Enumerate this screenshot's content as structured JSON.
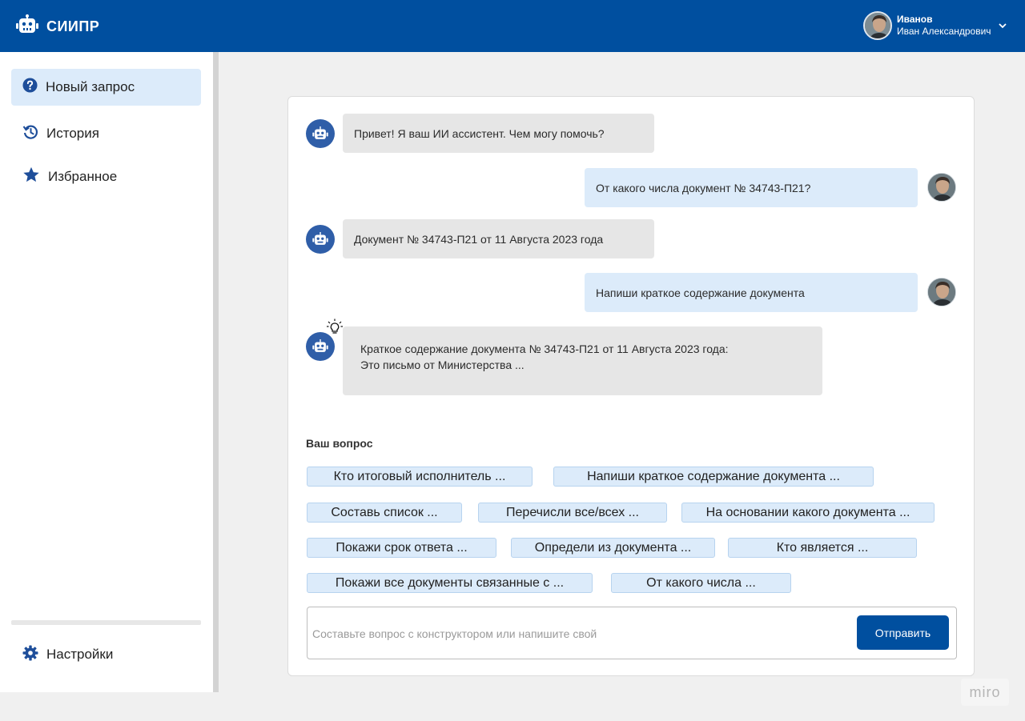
{
  "header": {
    "app_name": "СИИПР",
    "user_surname": "Иванов",
    "user_fullname": "Иван Александрович",
    "brand_color": "#004f9f"
  },
  "sidebar": {
    "items": [
      {
        "label": "Новый запрос",
        "icon": "question-circle-icon",
        "active": true
      },
      {
        "label": "История",
        "icon": "history-icon",
        "active": false
      },
      {
        "label": "Избранное",
        "icon": "star-icon",
        "active": false
      }
    ],
    "settings_label": "Настройки"
  },
  "chat": {
    "messages": [
      {
        "from": "bot",
        "text": "Привет! Я ваш ИИ ассистент. Чем могу помочь?"
      },
      {
        "from": "user",
        "text": "От какого числа документ № 34743-П21?"
      },
      {
        "from": "bot",
        "text": "Документ № 34743-П21 от 11 Августа 2023 года"
      },
      {
        "from": "user",
        "text": "Напиши краткое содержание документа"
      },
      {
        "from": "bot",
        "line1": "Краткое содержание документа № 34743-П21 от 11 Августа 2023 года:",
        "line2": "Это письмо от Министерства ..."
      }
    ]
  },
  "question": {
    "title": "Ваш вопрос",
    "suggestions": [
      "Кто итоговый исполнитель ...",
      "Напиши краткое содержание документа ...",
      "Составь список ...",
      "Перечисли все/всех ...",
      "На основании какого документа ...",
      "Покажи срок ответа ...",
      "Определи из документа ...",
      "Кто является ...",
      "Покажи все документы связанные с ...",
      "От какого числа ..."
    ],
    "input_placeholder": "Составьте вопрос с конструктором или напишите свой",
    "input_value": "",
    "send_label": "Отправить"
  },
  "watermark": "miro"
}
